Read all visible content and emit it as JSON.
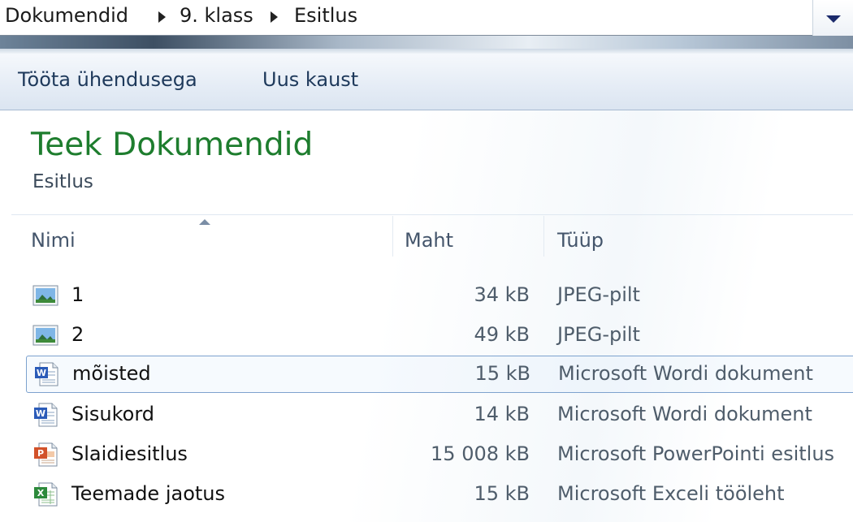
{
  "address_bar": {
    "crumbs": [
      "Dokumendid",
      "9. klass",
      "Esitlus"
    ]
  },
  "toolbar": {
    "share_label": "Tööta ühendusega",
    "new_folder_label": "Uus kaust"
  },
  "library": {
    "title": "Teek Dokumendid",
    "subtitle": "Esitlus"
  },
  "columns": {
    "name": "Nimi",
    "size": "Maht",
    "type": "Tüüp"
  },
  "files": [
    {
      "name": "1",
      "size": "34 kB",
      "type": "JPEG-pilt",
      "icon": "image-file-icon"
    },
    {
      "name": "2",
      "size": "49 kB",
      "type": "JPEG-pilt",
      "icon": "image-file-icon"
    },
    {
      "name": "mõisted",
      "size": "15 kB",
      "type": "Microsoft Wordi dokument",
      "icon": "word-document-icon",
      "selected": true
    },
    {
      "name": "Sisukord",
      "size": "14 kB",
      "type": "Microsoft Wordi dokument",
      "icon": "word-document-icon"
    },
    {
      "name": "Slaidiesitlus",
      "size": "15 008 kB",
      "type": "Microsoft PowerPointi esitlus",
      "icon": "powerpoint-file-icon"
    },
    {
      "name": "Teemade jaotus",
      "size": "15 kB",
      "type": "Microsoft Exceli tööleht",
      "icon": "excel-file-icon"
    }
  ],
  "colors": {
    "library_title": "#1e7d2e",
    "toolbar_text": "#1e395b",
    "selection_border": "#7da2ce"
  }
}
